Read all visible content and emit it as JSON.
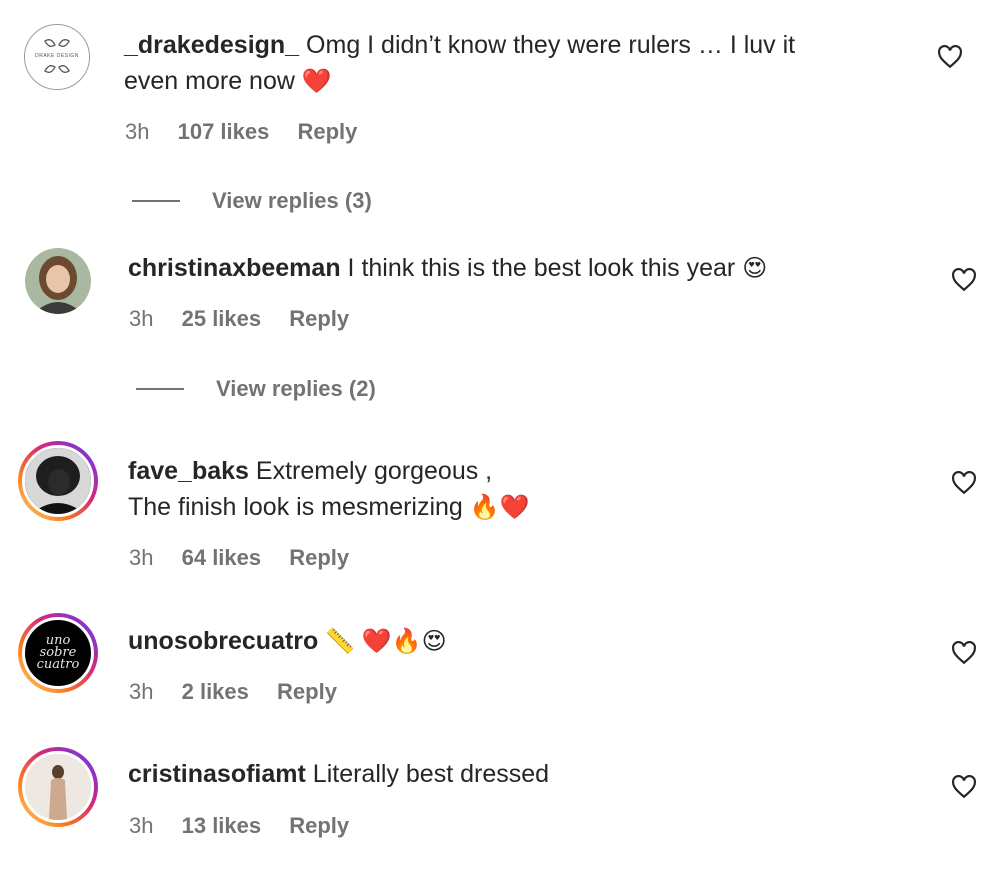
{
  "comments": [
    {
      "username": "_drakedesign_",
      "text_line1": "Omg I didn’t know they were rulers … I luv it",
      "text_line2": "even more now",
      "emoji": "❤️",
      "time": "3h",
      "likes": "107 likes",
      "reply": "Reply",
      "view_replies": "View replies (3)",
      "avatar_text": "DRAKE DESIGN"
    },
    {
      "username": "christinaxbeeman",
      "text": "I think this is the best look this year",
      "emoji": "😍",
      "time": "3h",
      "likes": "25 likes",
      "reply": "Reply",
      "view_replies": "View replies (2)"
    },
    {
      "username": "fave_baks",
      "text_line1": "Extremely gorgeous ,",
      "text_line2": "The finish look is mesmerizing",
      "emoji": "🔥❤️",
      "time": "3h",
      "likes": "64 likes",
      "reply": "Reply"
    },
    {
      "username": "unosobrecuatro",
      "emoji": "📏 ❤️🔥😍",
      "time": "3h",
      "likes": "2 likes",
      "reply": "Reply",
      "avatar_text": "uno sobre cuatro"
    },
    {
      "username": "cristinasofiamt",
      "text": "Literally best dressed",
      "time": "3h",
      "likes": "13 likes",
      "reply": "Reply"
    }
  ],
  "colors": {
    "text": "#262626",
    "secondary": "#737373",
    "story_ring": [
      "#feda75",
      "#fa7e1e",
      "#d62976",
      "#962fbf",
      "#4f5bd5"
    ]
  },
  "icons": {
    "like": "heart-outline-icon"
  }
}
